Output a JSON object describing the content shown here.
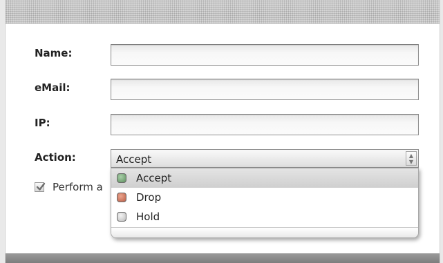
{
  "form": {
    "name_label": "Name:",
    "name_value": "",
    "email_label": "eMail:",
    "email_value": "",
    "ip_label": "IP:",
    "ip_value": "",
    "action_label": "Action:",
    "action_selected": "Accept",
    "checkbox_label": "Perform a",
    "checkbox_checked": true
  },
  "dropdown": {
    "options": [
      {
        "label": "Accept",
        "color": "#6f9a6f",
        "highlighted": true
      },
      {
        "label": "Drop",
        "color": "#c7735c",
        "highlighted": false
      },
      {
        "label": "Hold",
        "color": "#cfcfcf",
        "highlighted": false
      }
    ]
  },
  "colors": {
    "titlebar": "#d5d5d5",
    "content_bg": "#ffffff",
    "bottom_bar": "#8a8a8a"
  }
}
